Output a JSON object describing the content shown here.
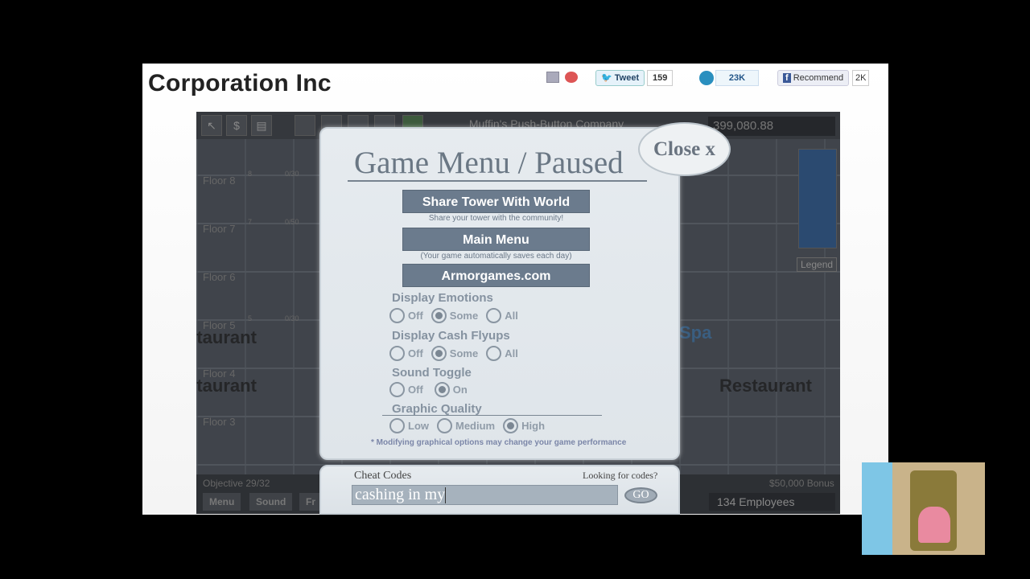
{
  "site": {
    "title": "Corporation Inc",
    "social": {
      "email_icon": "email-icon",
      "favorite_icon": "heart-icon",
      "tweet_label": "Tweet",
      "tweet_count": "159",
      "stumble_icon": "stumbleupon-icon",
      "stumble_count": "23K",
      "recommend_label": "Recommend",
      "recommend_count": "2K"
    }
  },
  "game": {
    "company": "Muffin's Push-Button Company",
    "money": "399,080.88",
    "toolbar": [
      "↖",
      "$",
      "▤"
    ],
    "floors": [
      "Floor 8",
      "Floor 7",
      "Floor 6",
      "Floor 5",
      "Floor 4",
      "Floor 3"
    ],
    "room_counts": [
      "8",
      "0/30",
      "7",
      "0/50",
      "5",
      "0/30"
    ],
    "restaurant": "Restaurant",
    "spa": "Spa",
    "legend": "Legend",
    "objective": "Objective 29/32",
    "bonus": "$50,000 Bonus",
    "employees": "134 Employees",
    "bottom_buttons": [
      "Menu",
      "Sound",
      "Fr"
    ]
  },
  "menu": {
    "title": "Game Menu / Paused",
    "close": "Close x",
    "share": {
      "label": "Share Tower With World",
      "sub": "Share your tower with the community!"
    },
    "main": {
      "label": "Main Menu",
      "sub": "(Your game automatically saves each day)"
    },
    "armor": {
      "label": "Armorgames.com"
    },
    "emotions": {
      "label": "Display Emotions",
      "options": [
        "Off",
        "Some",
        "All"
      ],
      "selected": "Some"
    },
    "cash": {
      "label": "Display Cash Flyups",
      "options": [
        "Off",
        "Some",
        "All"
      ],
      "selected": "Some"
    },
    "sound": {
      "label": "Sound Toggle",
      "options": [
        "Off",
        "On"
      ],
      "selected": "On"
    },
    "quality": {
      "label": "Graphic Quality",
      "options": [
        "Low",
        "Medium",
        "High"
      ],
      "selected": "High"
    },
    "note": "* Modifying graphical options may change your game performance"
  },
  "cheat": {
    "label": "Cheat Codes",
    "looking": "Looking for codes?",
    "value": "cashing in my",
    "go": "GO"
  }
}
